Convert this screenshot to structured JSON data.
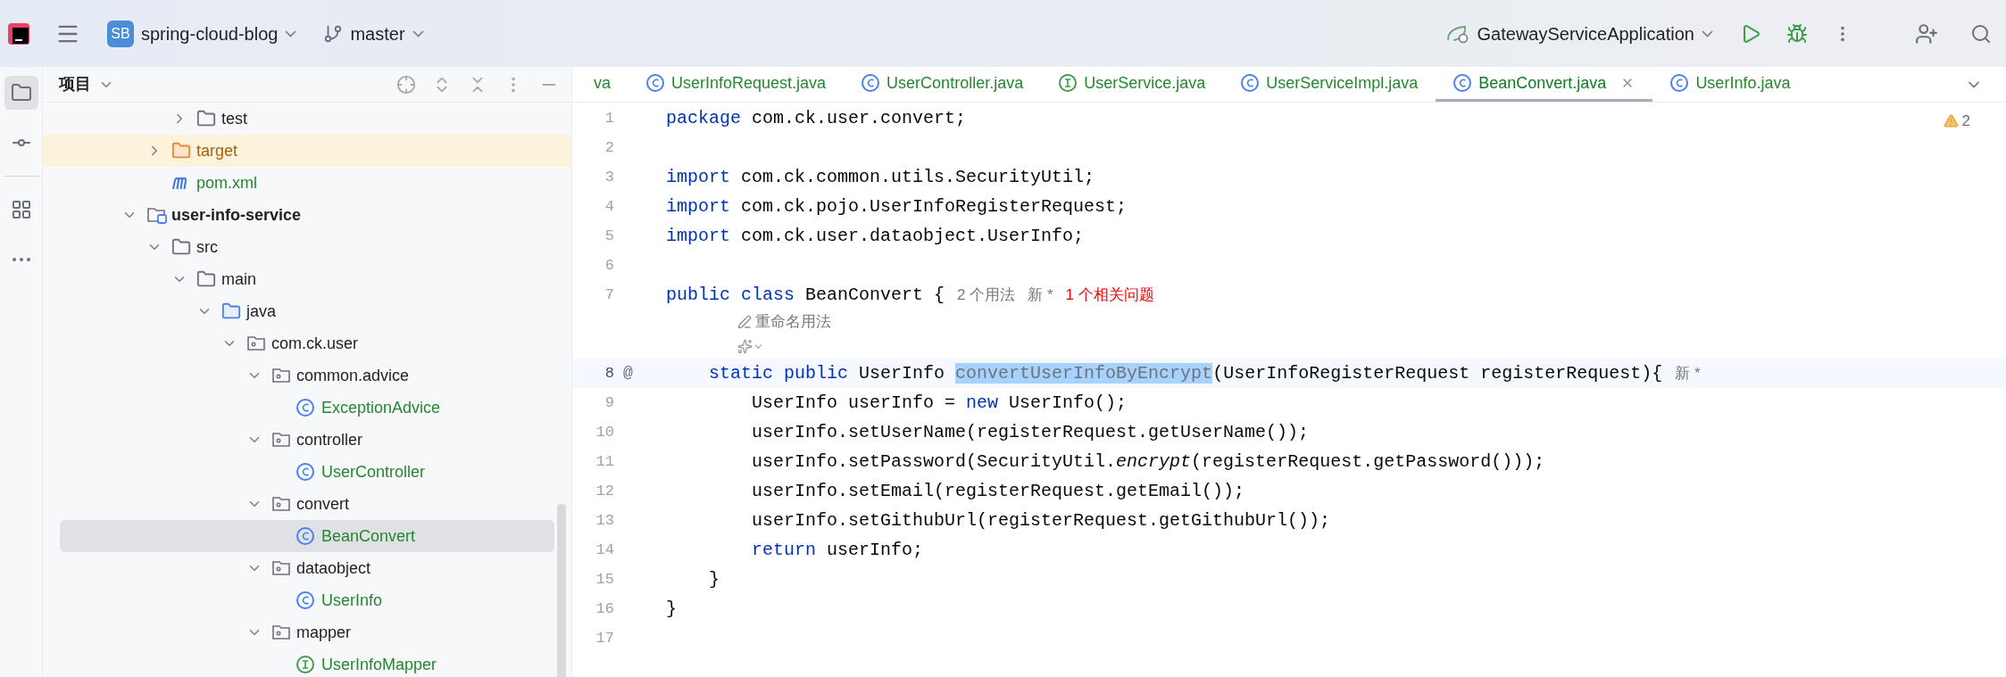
{
  "top_bar": {
    "project_badge": "SB",
    "project": "spring-cloud-blog",
    "branch": "master",
    "run_config": "GatewayServiceApplication"
  },
  "tool_strip": [
    {
      "kind": "project",
      "selected": true
    },
    {
      "kind": "commit",
      "selected": false
    },
    {
      "kind": "structure",
      "selected": false
    },
    {
      "kind": "more",
      "selected": false
    }
  ],
  "project_panel": {
    "title": "项目"
  },
  "tree": {
    "cut_off_parent": {
      "cut_off_parent": {
        "children": [
          {
            "name": "test",
            "kind": "folder",
            "expanded": false,
            "selected": false
          }
        ]
      },
      "children": [
        {
          "name": "target",
          "kind": "excluded-folder",
          "expanded": false,
          "selected": false
        },
        {
          "name": "pom.xml",
          "kind": "maven",
          "selected": false
        }
      ]
    },
    "items": [
      {
        "name": "user-info-service",
        "kind": "module",
        "expanded": true,
        "selected": false,
        "children": [
          {
            "name": "src",
            "kind": "folder",
            "expanded": true,
            "selected": false,
            "children": [
              {
                "name": "main",
                "kind": "folder",
                "expanded": true,
                "selected": false,
                "children": [
                  {
                    "name": "java",
                    "kind": "source-folder",
                    "expanded": true,
                    "selected": false,
                    "children": [
                      {
                        "name": "com.ck.user",
                        "kind": "package",
                        "expanded": true,
                        "selected": false,
                        "children": [
                          {
                            "name": "common.advice",
                            "kind": "package",
                            "expanded": true,
                            "selected": false,
                            "children": [
                              {
                                "name": "ExceptionAdvice",
                                "kind": "class",
                                "selected": false
                              }
                            ]
                          },
                          {
                            "name": "controller",
                            "kind": "package",
                            "expanded": true,
                            "selected": false,
                            "children": [
                              {
                                "name": "UserController",
                                "kind": "class",
                                "selected": false
                              }
                            ]
                          },
                          {
                            "name": "convert",
                            "kind": "package",
                            "expanded": true,
                            "selected": false,
                            "children": [
                              {
                                "name": "BeanConvert",
                                "kind": "class",
                                "selected": true
                              }
                            ]
                          },
                          {
                            "name": "dataobject",
                            "kind": "package",
                            "expanded": true,
                            "selected": false,
                            "children": [
                              {
                                "name": "UserInfo",
                                "kind": "class",
                                "selected": false
                              }
                            ]
                          },
                          {
                            "name": "mapper",
                            "kind": "package",
                            "expanded": true,
                            "selected": false,
                            "children": [
                              {
                                "name": "UserInfoMapper",
                                "kind": "interface",
                                "selected": false
                              }
                            ]
                          }
                        ]
                      }
                    ]
                  }
                ]
              }
            ]
          }
        ]
      }
    ]
  },
  "tabs": [
    {
      "label": "va",
      "selected": false
    },
    {
      "label": "UserInfoRequest.java",
      "kind": "class",
      "selected": false
    },
    {
      "label": "UserController.java",
      "kind": "class",
      "selected": false
    },
    {
      "label": "UserService.java",
      "kind": "interface",
      "selected": false
    },
    {
      "label": "UserServiceImpl.java",
      "kind": "class",
      "selected": false
    },
    {
      "label": "BeanConvert.java",
      "kind": "class",
      "selected": true
    },
    {
      "label": "UserInfo.java",
      "kind": "class",
      "selected": false
    }
  ],
  "editor": {
    "warnings": "2",
    "lines": [
      {
        "number": "1",
        "current": false,
        "tokens": [
          {
            "text": "package",
            "kind": "keyword"
          },
          {
            "text": " com.ck.user.convert;",
            "kind": "plain"
          }
        ]
      },
      {
        "number": "2",
        "current": false
      },
      {
        "number": "3",
        "current": false,
        "tokens": [
          {
            "text": "import",
            "kind": "keyword"
          },
          {
            "text": " com.ck.common.utils.SecurityUtil;",
            "kind": "plain"
          }
        ]
      },
      {
        "number": "4",
        "current": false,
        "tokens": [
          {
            "text": "import",
            "kind": "keyword"
          },
          {
            "text": " com.ck.pojo.UserInfoRegisterRequest;",
            "kind": "plain"
          }
        ]
      },
      {
        "number": "5",
        "current": false,
        "tokens": [
          {
            "text": "import",
            "kind": "keyword"
          },
          {
            "text": " com.ck.user.dataobject.UserInfo;",
            "kind": "plain"
          }
        ]
      },
      {
        "number": "6",
        "current": false
      },
      {
        "number": "7",
        "current": false,
        "tokens": [
          {
            "text": "public class",
            "kind": "keyword"
          },
          {
            "text": " BeanConvert {",
            "kind": "plain"
          }
        ],
        "hints": [
          {
            "text": "2 个用法",
            "kind": "usage"
          },
          {
            "text": "新 *",
            "kind": "usage"
          },
          {
            "text": "1 个相关问题",
            "kind": "problem"
          }
        ],
        "lens": "重命名用法",
        "ai_actions": true
      },
      {
        "number": "8",
        "current": true,
        "marker": "@",
        "tokens": [
          {
            "text": "    static public",
            "kind": "keyword"
          },
          {
            "text": " UserInfo ",
            "kind": "plain"
          },
          {
            "text": "convertUserInfoByEncrypt",
            "kind": "selected"
          },
          {
            "text": "(UserInfoRegisterRequest registerRequest){",
            "kind": "plain"
          }
        ],
        "hints": [
          {
            "text": "新 *",
            "kind": "usage"
          }
        ]
      },
      {
        "number": "9",
        "current": false,
        "tokens": [
          {
            "text": "        UserInfo userInfo = ",
            "kind": "plain"
          },
          {
            "text": "new",
            "kind": "keyword"
          },
          {
            "text": " UserInfo();",
            "kind": "plain"
          }
        ]
      },
      {
        "number": "10",
        "current": false,
        "tokens": [
          {
            "text": "        userInfo.setUserName(registerRequest.getUserName());",
            "kind": "plain"
          }
        ]
      },
      {
        "number": "11",
        "current": false,
        "tokens": [
          {
            "text": "        userInfo.setPassword(SecurityUtil.",
            "kind": "plain"
          },
          {
            "text": "encrypt",
            "kind": "italic"
          },
          {
            "text": "(registerRequest.getPassword()));",
            "kind": "plain"
          }
        ]
      },
      {
        "number": "12",
        "current": false,
        "tokens": [
          {
            "text": "        userInfo.setEmail(registerRequest.getEmail());",
            "kind": "plain"
          }
        ]
      },
      {
        "number": "13",
        "current": false,
        "tokens": [
          {
            "text": "        userInfo.setGithubUrl(registerRequest.getGithubUrl());",
            "kind": "plain"
          }
        ]
      },
      {
        "number": "14",
        "current": false,
        "tokens": [
          {
            "text": "        return",
            "kind": "keyword"
          },
          {
            "text": " userInfo;",
            "kind": "plain"
          }
        ]
      },
      {
        "number": "15",
        "current": false,
        "tokens": [
          {
            "text": "    }",
            "kind": "plain"
          }
        ]
      },
      {
        "number": "16",
        "current": false,
        "tokens": [
          {
            "text": "}",
            "kind": "plain"
          }
        ]
      },
      {
        "number": "17",
        "current": false
      }
    ]
  }
}
